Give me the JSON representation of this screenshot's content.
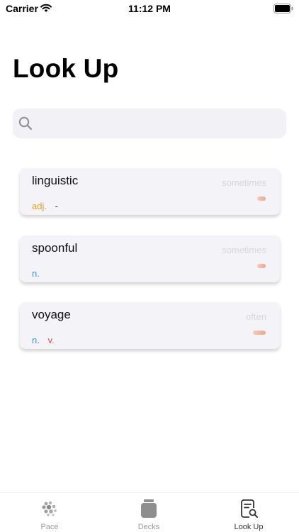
{
  "status_bar": {
    "carrier": "Carrier",
    "time": "11:12 PM"
  },
  "page": {
    "title": "Look Up"
  },
  "search": {
    "value": "",
    "placeholder": ""
  },
  "colors": {
    "adj": "#e5a02a",
    "n": "#3a8fe2",
    "v": "#e0514a",
    "freq_bar": "#e9a894"
  },
  "words": [
    {
      "word": "linguistic",
      "frequency": "sometimes",
      "pos": [
        "adj."
      ],
      "definition": "-"
    },
    {
      "word": "spoonful",
      "frequency": "sometimes",
      "pos": [
        "n."
      ]
    },
    {
      "word": "voyage",
      "frequency": "often",
      "pos": [
        "n.",
        "v."
      ]
    }
  ],
  "tab_bar": {
    "tabs": [
      {
        "label": "Pace",
        "icon": "pace-dots-icon",
        "active": false
      },
      {
        "label": "Decks",
        "icon": "deck-jar-icon",
        "active": false
      },
      {
        "label": "Look Up",
        "icon": "lookup-document-icon",
        "active": true
      }
    ]
  }
}
